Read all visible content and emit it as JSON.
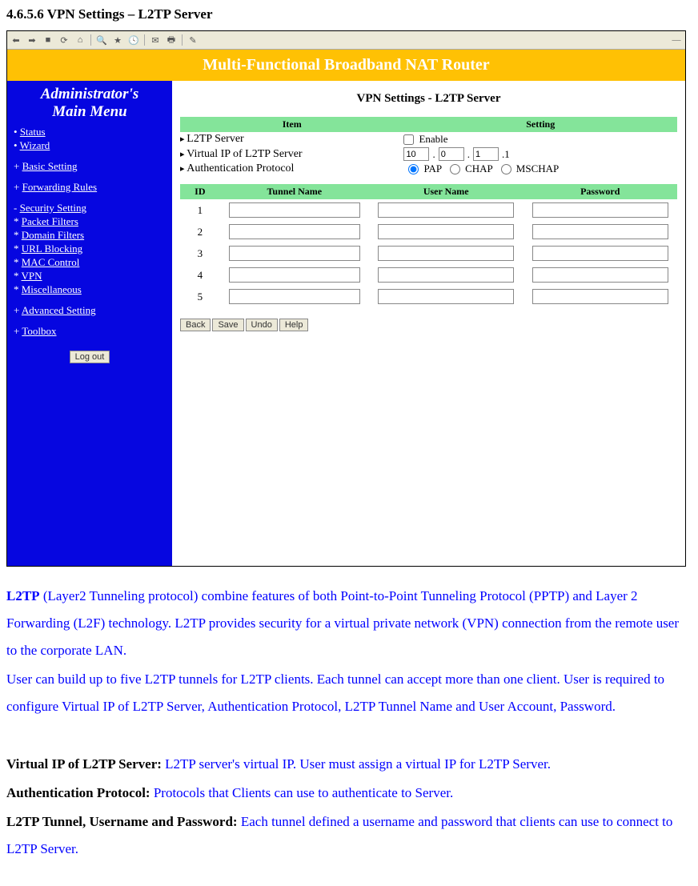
{
  "heading": "4.6.5.6 VPN Settings – L2TP Server",
  "banner": "Multi-Functional Broadband NAT Router",
  "sidebar": {
    "title1": "Administrator's",
    "title2": "Main Menu",
    "items": [
      {
        "label": "Status",
        "cls": "bullet",
        "link": true
      },
      {
        "label": "Wizard",
        "cls": "bullet",
        "link": true
      },
      {
        "label": "Basic Setting",
        "cls": "plus",
        "link": true,
        "gap": true
      },
      {
        "label": "Forwarding Rules",
        "cls": "plus",
        "link": true,
        "gap": true
      },
      {
        "label": "Security Setting",
        "cls": "minus",
        "link": true,
        "gap": true
      },
      {
        "label": "Packet Filters",
        "cls": "star",
        "link": true,
        "sub": true
      },
      {
        "label": "Domain Filters",
        "cls": "star",
        "link": true,
        "sub": true
      },
      {
        "label": "URL Blocking",
        "cls": "star",
        "link": true,
        "sub": true
      },
      {
        "label": "MAC Control",
        "cls": "star",
        "link": true,
        "sub": true
      },
      {
        "label": "VPN",
        "cls": "star",
        "link": true,
        "sub": true
      },
      {
        "label": "Miscellaneous",
        "cls": "star",
        "link": true,
        "sub": true
      },
      {
        "label": "Advanced Setting",
        "cls": "plus",
        "link": true,
        "gap": true
      },
      {
        "label": "Toolbox",
        "cls": "plus",
        "link": true,
        "gap": true
      }
    ],
    "logout": "Log out"
  },
  "content": {
    "page_title": "VPN Settings - L2TP Server",
    "item_hdr": "Item",
    "setting_hdr": "Setting",
    "rows": {
      "r0_label": "L2TP Server",
      "r0_enable": "Enable",
      "r1_label": "Virtual IP of L2TP Server",
      "ip_a": "10",
      "ip_b": "0",
      "ip_c": "1",
      "ip_d": ".1",
      "r2_label": "Authentication Protocol",
      "pap": "PAP",
      "chap": "CHAP",
      "mschap": "MSCHAP"
    },
    "table": {
      "id": "ID",
      "tn": "Tunnel Name",
      "un": "User Name",
      "pw": "Password",
      "ids": [
        "1",
        "2",
        "3",
        "4",
        "5"
      ]
    },
    "buttons": {
      "back": "Back",
      "save": "Save",
      "undo": "Undo",
      "help": "Help"
    }
  },
  "doc": {
    "p1a": "L2TP",
    "p1b": " (Layer2 Tunneling protocol) combine features of both Point-to-Point Tunneling Protocol (PPTP) and Layer 2 Forwarding (L2F) technology. L2TP provides security for a virtual private network (VPN) connection from the remote user to the corporate LAN.",
    "p2": "User can build up to five L2TP tunnels for L2TP clients. Each tunnel can accept more than one client. User is required to configure Virtual IP of L2TP Server, Authentication Protocol, L2TP Tunnel Name and User Account, Password.",
    "p3a": "Virtual IP of L2TP Server: ",
    "p3b": "L2TP server's virtual IP. User must assign a virtual IP for L2TP Server.",
    "p4a": "Authentication Protocol: ",
    "p4b": "Protocols that Clients can use to authenticate to Server.",
    "p5a": "L2TP Tunnel, Username and Password: ",
    "p5b": "Each tunnel defined a username and password that clients can use to connect to L2TP Server."
  }
}
